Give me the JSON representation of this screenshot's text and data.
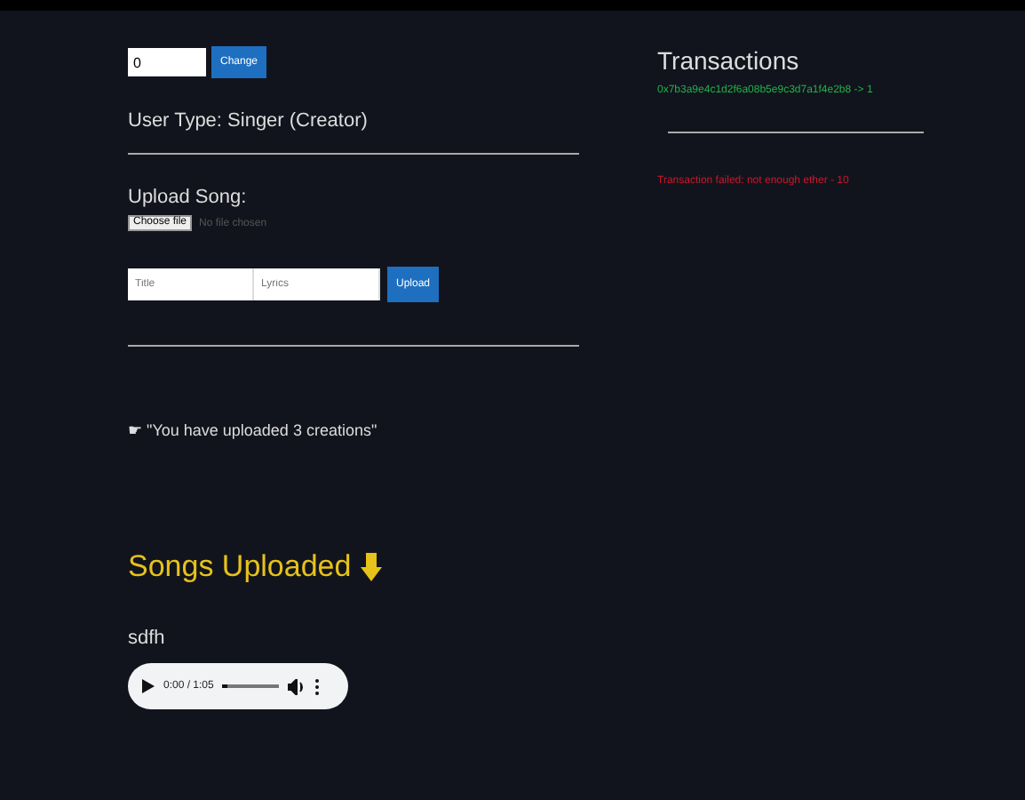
{
  "account": {
    "value": "0",
    "button": "Change"
  },
  "user_type": "User Type: Singer (Creator)",
  "upload": {
    "heading": "Upload Song:",
    "file_button": "Choose file",
    "file_status": "No file chosen",
    "title_placeholder": "Title",
    "lyrics_placeholder": "Lyrics",
    "button": "Upload"
  },
  "message": "☛ \"You have uploaded 3 creations\"",
  "songs_heading": "Songs Uploaded",
  "songs": [
    {
      "name": "sdfh",
      "time": "0:00 / 1:05",
      "level": 0
    }
  ],
  "transactions": {
    "title": "Transactions",
    "items": [
      {
        "text": "0x7b3a9e4c1d2f6a08b5e9c3d7a1f4e2b8 -> 1",
        "color": "#1fb24a"
      },
      {
        "text": "Transaction failed: not enough ether - 10",
        "color": "#d0162a"
      }
    ]
  }
}
